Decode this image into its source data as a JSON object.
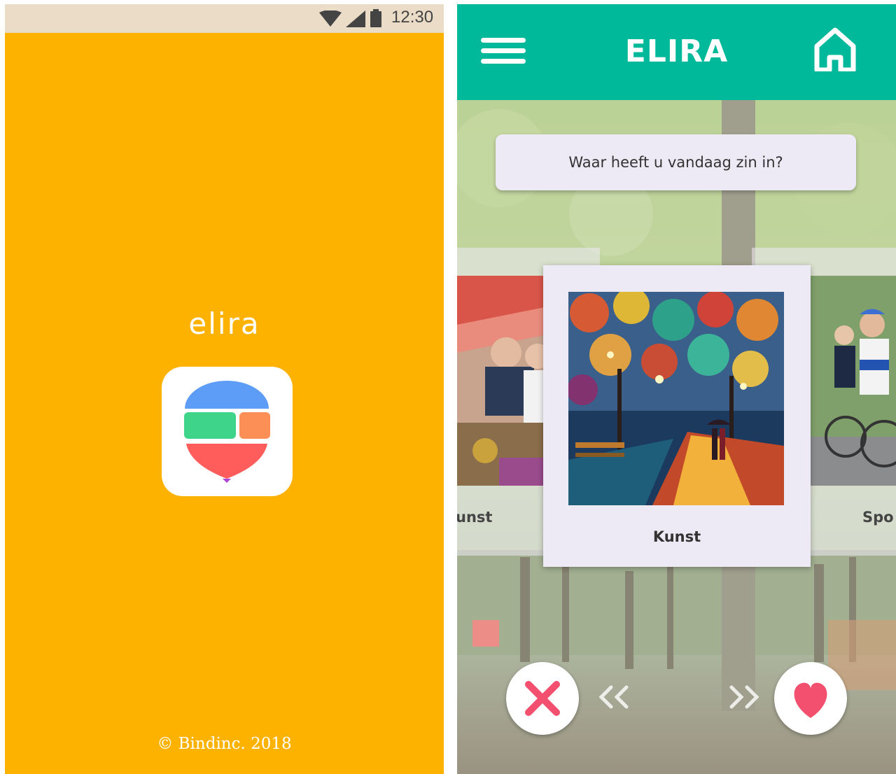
{
  "splash": {
    "status_time": "12:30",
    "app_name": "elira",
    "copyright": "© Bindinc. 2018",
    "background": "#FEB200"
  },
  "app": {
    "title": "ELIRA",
    "header_color": "#00B89A",
    "prompt": "Waar heeft u vandaag zin in?",
    "cards": {
      "left_label": "unst",
      "center_label": "Kunst",
      "right_label": "Spo"
    },
    "icons": {
      "menu": "menu-icon",
      "home": "home-icon",
      "reject": "close-icon",
      "like": "heart-icon"
    },
    "accent_reject": "#F2506E",
    "accent_like": "#F2506E"
  }
}
